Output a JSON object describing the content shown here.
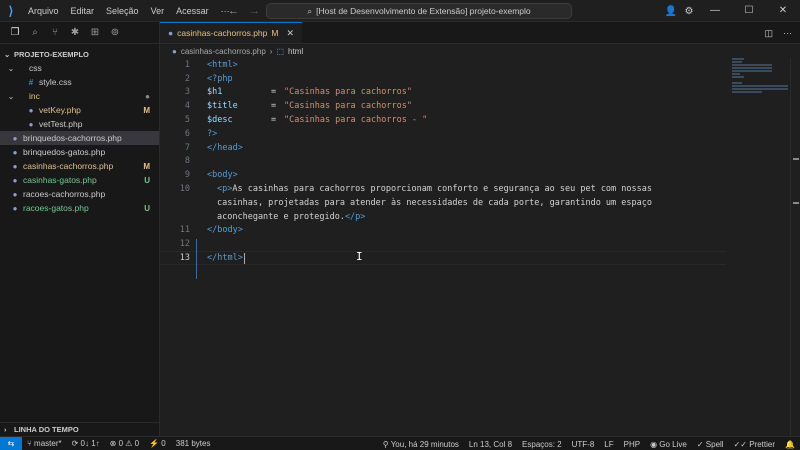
{
  "titlebar": {
    "menu": [
      "Arquivo",
      "Editar",
      "Seleção",
      "Ver",
      "Acessar",
      "···"
    ],
    "command_center": "[Host de Desenvolvimento de Extensão] projeto-exemplo"
  },
  "sidebar": {
    "explorer_title": "PROJETO-EXEMPLO",
    "items": [
      {
        "label": "css",
        "type": "folder",
        "depth": 1,
        "badge": ""
      },
      {
        "label": "style.css",
        "type": "css",
        "depth": 2,
        "badge": ""
      },
      {
        "label": "inc",
        "type": "folder",
        "depth": 1,
        "badge": "●"
      },
      {
        "label": "vetKey.php",
        "type": "php",
        "depth": 2,
        "badge": "M"
      },
      {
        "label": "vetTest.php",
        "type": "php",
        "depth": 2,
        "badge": ""
      },
      {
        "label": "brinquedos-cachorros.php",
        "type": "php",
        "depth": 1,
        "badge": ""
      },
      {
        "label": "brinquedos-gatos.php",
        "type": "php",
        "depth": 1,
        "badge": ""
      },
      {
        "label": "casinhas-cachorros.php",
        "type": "php",
        "depth": 1,
        "badge": "M"
      },
      {
        "label": "casinhas-gatos.php",
        "type": "php",
        "depth": 1,
        "badge": "U"
      },
      {
        "label": "racoes-cachorros.php",
        "type": "php",
        "depth": 1,
        "badge": ""
      },
      {
        "label": "racoes-gatos.php",
        "type": "php",
        "depth": 1,
        "badge": "U"
      }
    ],
    "timeline_title": "LINHA DO TEMPO"
  },
  "editor": {
    "tab_label": "casinhas-cachorros.php",
    "tab_badge": "M",
    "breadcrumb_file": "casinhas-cachorros.php",
    "breadcrumb_symbol": "html",
    "lines": {
      "n1": "1",
      "n2": "2",
      "n3": "3",
      "n4": "4",
      "n5": "5",
      "n6": "6",
      "n7": "7",
      "n8": "8",
      "n9": "9",
      "n10": "10",
      "n11": "11",
      "n12": "12",
      "n13": "13"
    },
    "code": {
      "l3_var": "$h1",
      "l3_str": "\"Casinhas para cachorros\"",
      "l4_var": "$title",
      "l4_str": "\"Casinhas para cachorros\"",
      "l5_var": "$desc",
      "l5_str": "\"Casinhas para cachorros - \"",
      "p_text_1": "As casinhas para cachorros proporcionam conforto e segurança ao seu pet com nossas",
      "p_text_2": "casinhas, projetadas para atender às necessidades de cada porte, garantindo um espaço",
      "p_text_3": "aconchegante e protegido."
    }
  },
  "statusbar": {
    "branch": "master*",
    "sync": "0↓ 1↑",
    "problems": "⊗ 0 ⚠ 0",
    "ports": "⚡ 0",
    "size": "381 bytes",
    "blame": "You, há 29 minutos",
    "position": "Ln 13, Col 8",
    "spaces": "Espaços: 2",
    "encoding": "UTF-8",
    "eol": "LF",
    "language": "PHP",
    "golive": "Go Live",
    "spell": "Spell",
    "prettier": "Prettier"
  },
  "colors": {
    "accent": "#0078d4",
    "modified": "#e2c08d",
    "untracked": "#73c991"
  }
}
